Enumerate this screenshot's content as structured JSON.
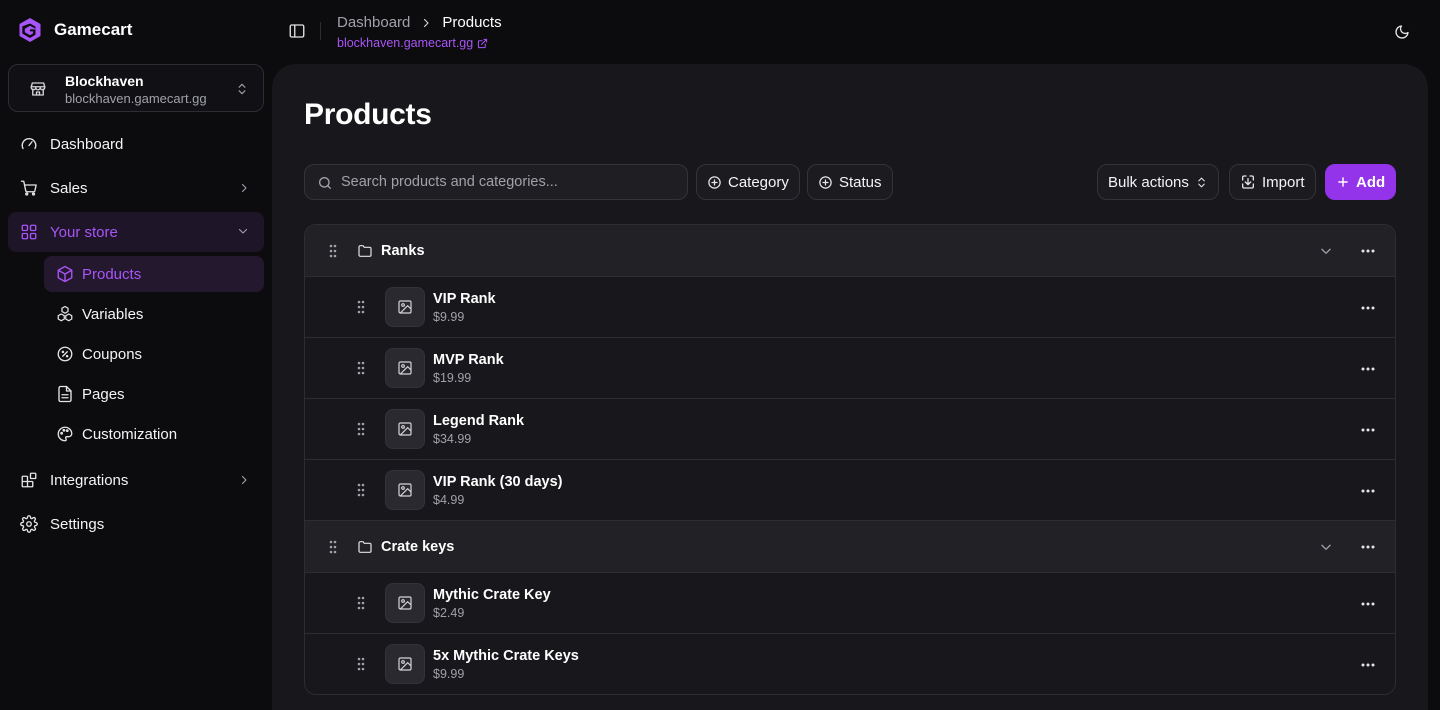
{
  "app": {
    "name": "Gamecart"
  },
  "store": {
    "name": "Blockhaven",
    "domain": "blockhaven.gamecart.gg"
  },
  "nav": {
    "dashboard": "Dashboard",
    "sales": "Sales",
    "your_store": "Your store",
    "sub": {
      "products": "Products",
      "variables": "Variables",
      "coupons": "Coupons",
      "pages": "Pages",
      "customization": "Customization"
    },
    "integrations": "Integrations",
    "settings": "Settings"
  },
  "breadcrumb": {
    "parent": "Dashboard",
    "current": "Products",
    "store_link": "blockhaven.gamecart.gg"
  },
  "page": {
    "title": "Products"
  },
  "toolbar": {
    "search_placeholder": "Search products and categories...",
    "category_filter": "Category",
    "status_filter": "Status",
    "bulk_actions": "Bulk actions",
    "import": "Import",
    "add": "Add"
  },
  "categories": [
    {
      "name": "Ranks",
      "products": [
        {
          "name": "VIP Rank",
          "price": "$9.99"
        },
        {
          "name": "MVP Rank",
          "price": "$19.99"
        },
        {
          "name": "Legend Rank",
          "price": "$34.99"
        },
        {
          "name": "VIP Rank (30 days)",
          "price": "$4.99"
        }
      ]
    },
    {
      "name": "Crate keys",
      "products": [
        {
          "name": "Mythic Crate Key",
          "price": "$2.49"
        },
        {
          "name": "5x Mythic Crate Keys",
          "price": "$9.99"
        }
      ]
    }
  ],
  "colors": {
    "accent": "#a855f7",
    "accent_button": "#9333ea",
    "background": "#0c0b0e",
    "panel": "#18171b"
  }
}
